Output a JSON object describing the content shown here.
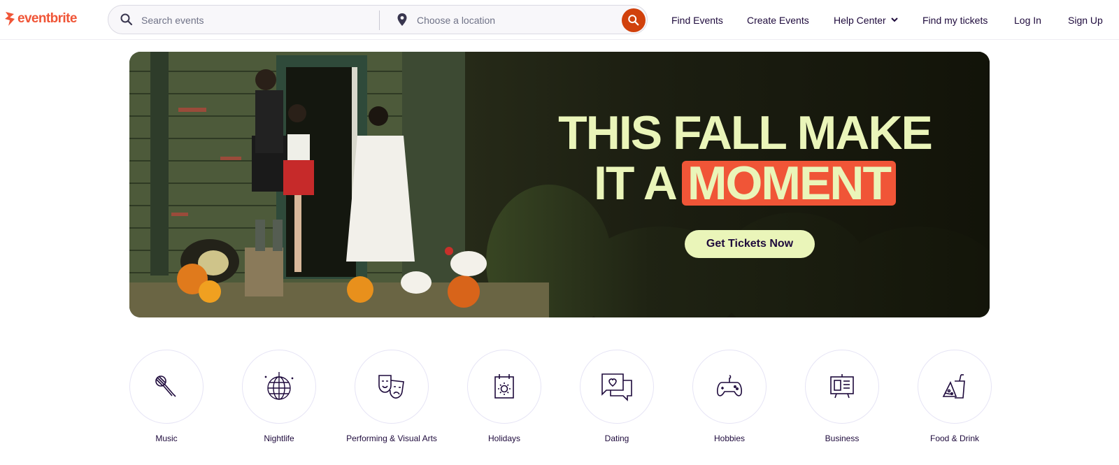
{
  "brand": {
    "name": "eventbrite",
    "color": "#f05537"
  },
  "search": {
    "events_placeholder": "Search events",
    "location_placeholder": "Choose a location",
    "button_color": "#d1410c",
    "icons": {
      "search": "search-icon",
      "location": "map-pin-icon",
      "submit": "search-icon"
    }
  },
  "nav": {
    "find_events": "Find Events",
    "create_events": "Create Events",
    "help_center": "Help Center",
    "find_tickets": "Find my tickets",
    "log_in": "Log In",
    "sign_up": "Sign Up"
  },
  "hero": {
    "title_line1": "THIS FALL MAKE",
    "title_line2": "IT A",
    "title_highlight": "MOMENT",
    "cta": "Get Tickets Now",
    "title_color": "#eaf5b9",
    "highlight_color": "#f05537"
  },
  "categories": [
    {
      "label": "Music",
      "icon": "microphone-icon"
    },
    {
      "label": "Nightlife",
      "icon": "disco-ball-icon"
    },
    {
      "label": "Performing & Visual Arts",
      "icon": "theater-masks-icon"
    },
    {
      "label": "Holidays",
      "icon": "calendar-sun-icon"
    },
    {
      "label": "Dating",
      "icon": "chat-heart-icon"
    },
    {
      "label": "Hobbies",
      "icon": "game-controller-icon"
    },
    {
      "label": "Business",
      "icon": "presentation-board-icon"
    },
    {
      "label": "Food & Drink",
      "icon": "pizza-drink-icon"
    }
  ]
}
